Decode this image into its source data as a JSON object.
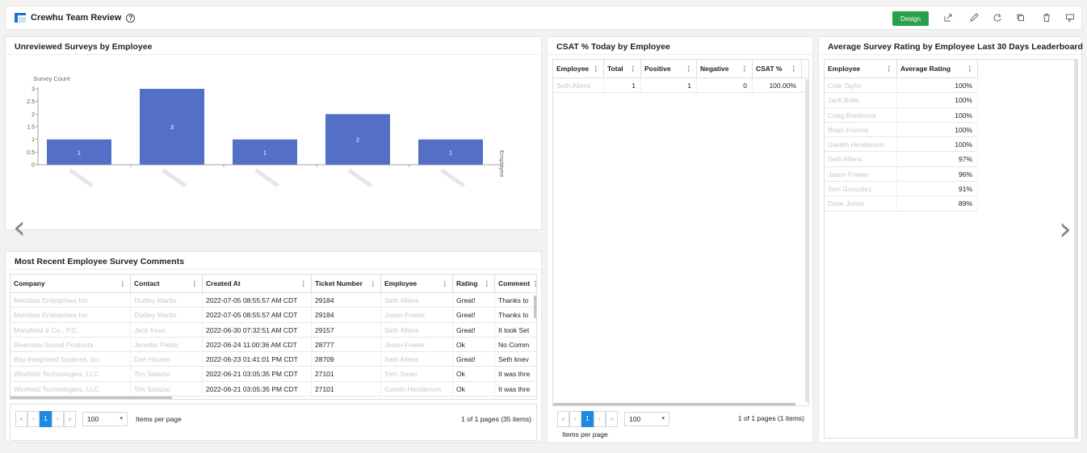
{
  "header": {
    "title": "Crewhu Team Review",
    "help_icon": "?",
    "design_label": "Design"
  },
  "toolbar_icons": [
    "share-icon",
    "edit-icon",
    "refresh-icon",
    "copy-icon",
    "delete-icon",
    "comment-icon"
  ],
  "unreviewed": {
    "title": "Unreviewed Surveys by Employee",
    "chart_data": {
      "type": "bar",
      "ylabel": "Survey Count",
      "xlabel": "Employee",
      "ylim": [
        0,
        3
      ],
      "yticks": [
        "3",
        "2.5",
        "2",
        "1.5",
        "1",
        "0.5",
        "0"
      ],
      "values": [
        1,
        3,
        1,
        2,
        1
      ],
      "data_labels": [
        "1",
        "3",
        "1",
        "2",
        "1"
      ],
      "bar_color": "#5470c6"
    }
  },
  "csat": {
    "title": "CSAT % Today by Employee",
    "columns": [
      "Employee",
      "Total",
      "Positive",
      "Negative",
      "CSAT %"
    ],
    "rows": [
      [
        "Seth Allens",
        "1",
        "1",
        "0",
        "100.00%"
      ]
    ],
    "page": "1",
    "page_size": "100",
    "items_per_page": "Items per page",
    "page_info": "1 of 1 pages (1 items)"
  },
  "leaderboard": {
    "title": "Average Survey Rating by Employee Last 30 Days Leaderboard",
    "columns": [
      "Employee",
      "Average Rating"
    ],
    "rows": [
      [
        "Cole Taylor",
        "100%"
      ],
      [
        "Jack Bolle",
        "100%"
      ],
      [
        "Craig Bredmore",
        "100%"
      ],
      [
        "Brian Francis",
        "100%"
      ],
      [
        "Gareth Henderson",
        "100%"
      ],
      [
        "Seth Allens",
        "97%"
      ],
      [
        "Jason Fowler",
        "96%"
      ],
      [
        "Tom Gonzalez",
        "91%"
      ],
      [
        "Dave Jones",
        "89%"
      ]
    ]
  },
  "comments": {
    "title": "Most Recent Employee Survey Comments",
    "columns": [
      "Company",
      "Contact",
      "Created At",
      "Ticket Number",
      "Employee",
      "Rating",
      "Comment"
    ],
    "rows": [
      [
        "Meridian Enterprises Inc",
        "Dudley Martin",
        "2022-07-05 08:55:57 AM CDT",
        "29184",
        "Seth Allens",
        "Great!",
        "Thanks to"
      ],
      [
        "Meridian Enterprises Inc",
        "Dudley Martin",
        "2022-07-05 08:55:57 AM CDT",
        "29184",
        "Jason Fowler",
        "Great!",
        "Thanks to"
      ],
      [
        "Mansfield & Co., P.C.",
        "Jack Kess",
        "2022-06-30 07:32:51 AM CDT",
        "29157",
        "Seth Allens",
        "Great!",
        "It took Set"
      ],
      [
        "Riverside Sound Products",
        "Jennifer Pablo",
        "2022-06-24 11:00:36 AM CDT",
        "28777",
        "Jason Fowler",
        "Ok",
        "No Comm"
      ],
      [
        "Bay Integrated Systems, Inc",
        "Dan Hauser",
        "2022-06-23 01:41:01 PM CDT",
        "28709",
        "Seth Allens",
        "Great!",
        "Seth knev"
      ],
      [
        "Wirefield Technologies, LLC",
        "Tim Salazar",
        "2022-06-21 03:05:35 PM CDT",
        "27101",
        "Tom Jones",
        "Ok",
        "It was thre"
      ],
      [
        "Wirefield Technologies, LLC",
        "Tim Salazar",
        "2022-06-21 03:05:35 PM CDT",
        "27101",
        "Gareth Henderson",
        "Ok",
        "It was thre"
      ]
    ],
    "page": "1",
    "page_size": "100",
    "items_per_page": "Items per page",
    "page_info": "1 of 1 pages (35 items)"
  },
  "carousel": {
    "prev": "‹",
    "next": "›"
  }
}
